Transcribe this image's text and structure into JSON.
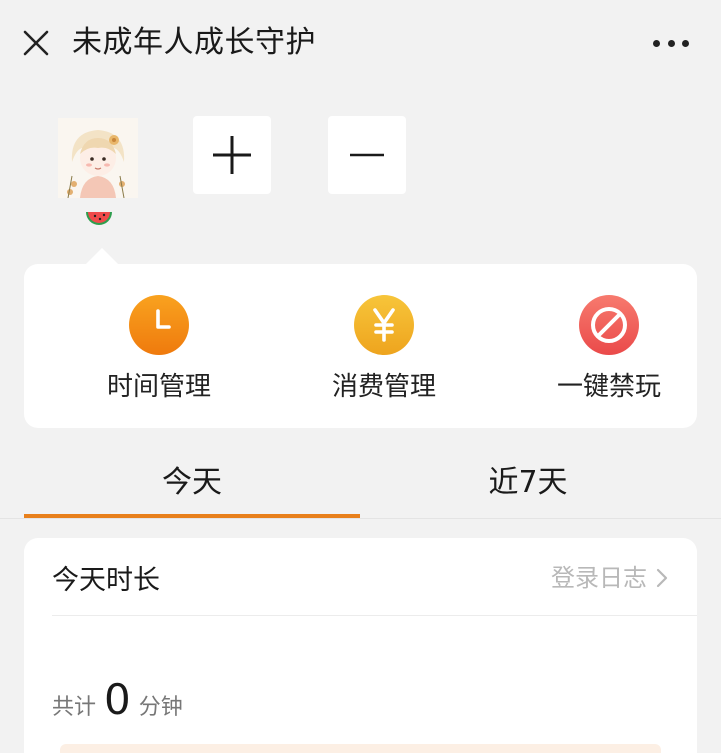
{
  "header": {
    "title": "未成年人成长守护",
    "close_icon": "close-icon",
    "more_icon": "more-dots-icon"
  },
  "profile": {
    "avatar_icon": "child-avatar",
    "badge_icon": "watermelon-icon",
    "add_icon": "plus-icon",
    "remove_icon": "minus-icon"
  },
  "functions": [
    {
      "label": "时间管理",
      "icon": "clock-icon",
      "color": "#f28a12"
    },
    {
      "label": "消费管理",
      "icon": "yuan-icon",
      "color": "#f1b32a"
    },
    {
      "label": "一键禁玩",
      "icon": "ban-icon",
      "color": "#ef5350"
    }
  ],
  "tabs": {
    "items": [
      "今天",
      "近7天"
    ],
    "active": "今天",
    "accent": "#e8801c"
  },
  "duration": {
    "title": "今天时长",
    "log_link": "登录日志",
    "total_label": "共计",
    "total_value": "0",
    "total_unit": "分钟"
  }
}
